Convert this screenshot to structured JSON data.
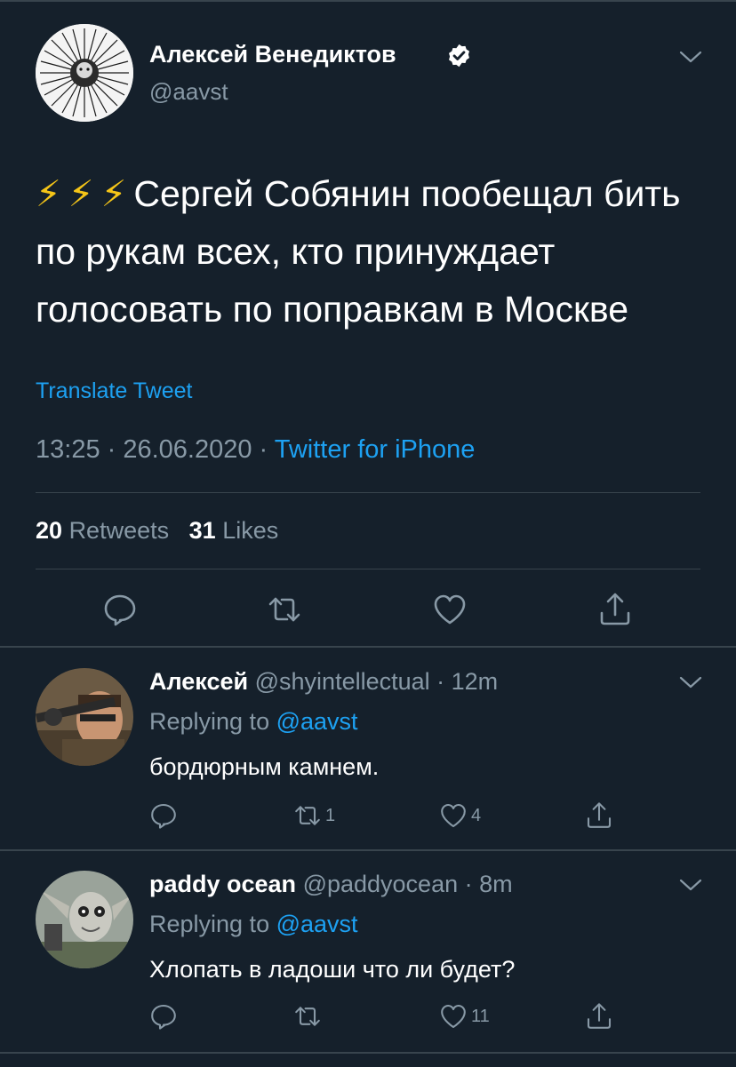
{
  "colors": {
    "background": "#15202b",
    "accent": "#1da1f2",
    "secondary_text": "#8899a6",
    "divider": "#38444d"
  },
  "main_tweet": {
    "author_name": "Алексей Венедиктов",
    "author_handle": "@aavst",
    "verified_icon": "verified-badge-icon",
    "emoji": [
      "⚡",
      "⚡",
      "⚡"
    ],
    "text": "Сергей Собянин пообещал бить по рукам всех, кто принуждает голосовать по поправкам в Москве",
    "translate_label": "Translate Tweet",
    "timestamp": "13:25 · 26.06.2020 · ",
    "source": "Twitter for iPhone",
    "retweets_count": "20",
    "retweets_label": "Retweets",
    "likes_count": "31",
    "likes_label": "Likes"
  },
  "replies": [
    {
      "author_name": "Алексей",
      "author_handle": "@shyintellectual · 12m",
      "replying_prefix": "Replying to ",
      "replying_to": "@aavst",
      "text": "бордюрным камнем.",
      "reply_count": "",
      "retweet_count": "1",
      "like_count": "4"
    },
    {
      "author_name": "paddy ocean",
      "author_handle": "@paddyocean · 8m",
      "replying_prefix": "Replying to ",
      "replying_to": "@aavst",
      "text": "Хлопать в ладоши что ли будет?",
      "reply_count": "",
      "retweet_count": "",
      "like_count": "11"
    }
  ]
}
